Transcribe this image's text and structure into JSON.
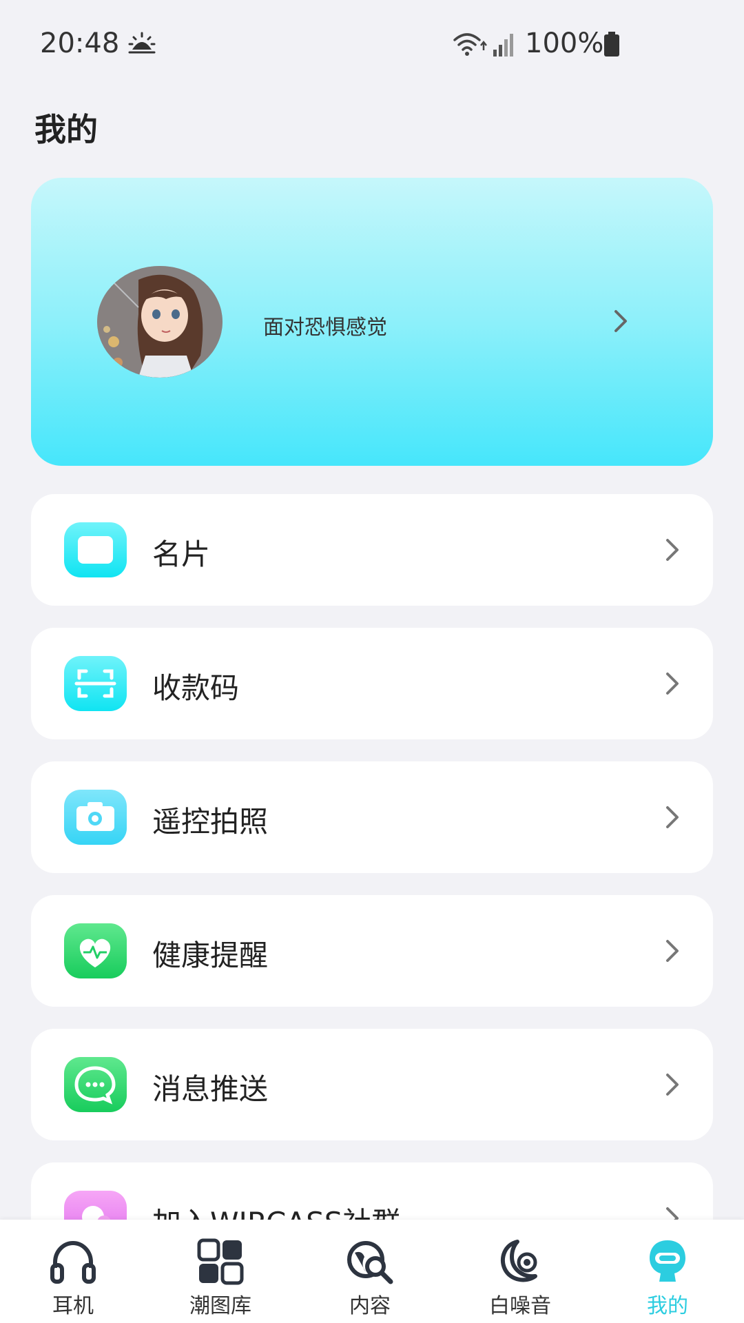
{
  "status_bar": {
    "time": "20:48",
    "battery": "100%"
  },
  "page": {
    "title": "我的"
  },
  "profile": {
    "name": "面对恐惧感觉"
  },
  "menu": [
    {
      "label": "名片",
      "icon": "card-icon",
      "color": "#1ee8f4"
    },
    {
      "label": "收款码",
      "icon": "scan-icon",
      "color": "#1ee8f4"
    },
    {
      "label": "遥控拍照",
      "icon": "camera-icon",
      "color": "#4ddcf7"
    },
    {
      "label": "健康提醒",
      "icon": "heart-icon",
      "color": "#25d36b"
    },
    {
      "label": "消息推送",
      "icon": "chat-icon",
      "color": "#25d36b"
    },
    {
      "label": "加入WIRCASS社群",
      "icon": "community-icon",
      "color": "#f07cf0"
    }
  ],
  "bottom_nav": [
    {
      "label": "耳机",
      "icon": "headphones-icon"
    },
    {
      "label": "潮图库",
      "icon": "gallery-icon"
    },
    {
      "label": "内容",
      "icon": "globe-search-icon"
    },
    {
      "label": "白噪音",
      "icon": "moon-sound-icon"
    },
    {
      "label": "我的",
      "icon": "robot-icon",
      "active": true
    }
  ],
  "colors": {
    "accent": "#2ccde0",
    "background": "#f2f2f6"
  }
}
